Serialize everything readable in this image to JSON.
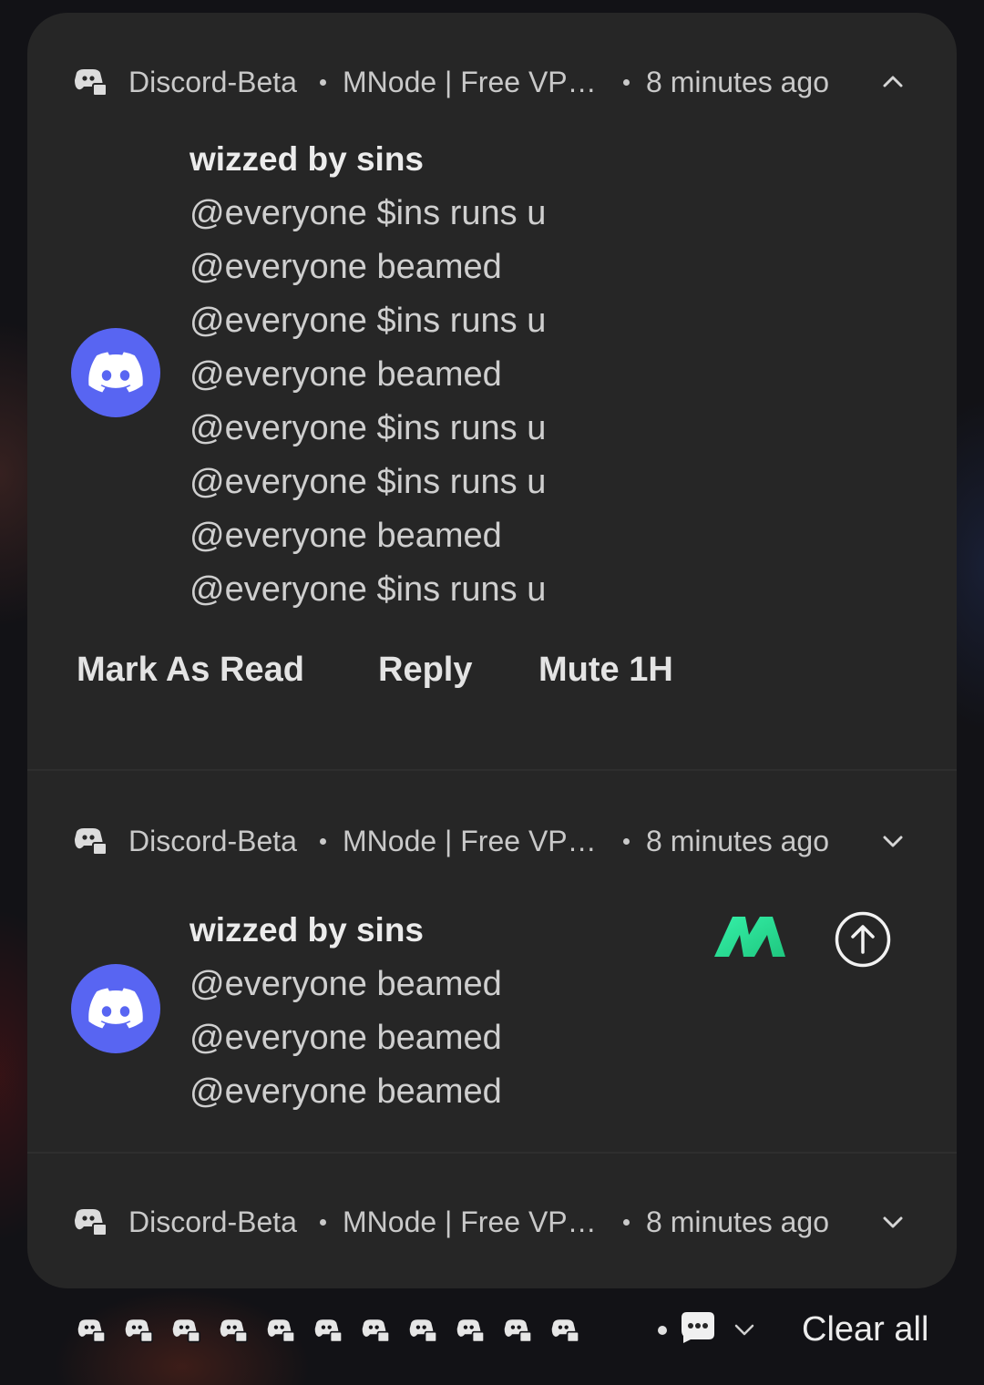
{
  "notifications": [
    {
      "app_name": "Discord-Beta",
      "channel": "MNode | Free VP…",
      "time": "8 minutes ago",
      "expanded": true,
      "title": "wizzed by sins",
      "messages": [
        "@everyone $ins runs u",
        "@everyone beamed",
        "@everyone $ins runs u",
        "@everyone beamed",
        "@everyone $ins runs u",
        "@everyone $ins runs u",
        "@everyone beamed",
        "@everyone $ins runs u"
      ],
      "actions": [
        "Mark As Read",
        "Reply",
        "Mute 1H"
      ]
    },
    {
      "app_name": "Discord-Beta",
      "channel": "MNode | Free VP…",
      "time": "8 minutes ago",
      "expanded": false,
      "title": "wizzed by sins",
      "messages": [
        "@everyone beamed",
        "@everyone beamed",
        "@everyone beamed"
      ]
    },
    {
      "app_name": "Discord-Beta",
      "channel": "MNode | Free VP…",
      "time": "8 minutes ago",
      "expanded": false
    }
  ],
  "bottom_bar": {
    "app_icon_count": 11,
    "clear_all_label": "Clear all"
  },
  "colors": {
    "panel": "#262626",
    "discord_blurple": "#5865F2",
    "mnode_green": "#2EE59D"
  },
  "icons": {
    "app_icon": "discord-game-controller-icon",
    "avatar": "discord-logo-icon",
    "expand": "chevron-up-icon",
    "collapse": "chevron-down-icon",
    "upload": "arrow-up-circle-icon",
    "brand": "mnode-logo-icon",
    "overflow": "chat-bubble-dots-icon"
  }
}
